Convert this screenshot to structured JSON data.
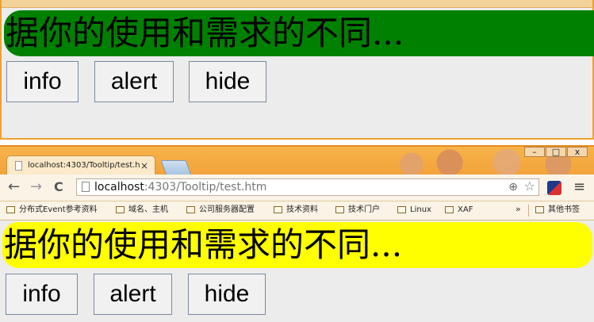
{
  "window_top": {
    "banner_text": "据你的使用和需求的不同...",
    "banner_color": "#008000",
    "buttons": {
      "info": "info",
      "alert": "alert",
      "hide": "hide"
    }
  },
  "window_bottom": {
    "tab": {
      "title": "localhost:4303/Tooltip/test.h",
      "close": "×"
    },
    "window_controls": {
      "minimize": "–",
      "maximize": "□",
      "close": "x"
    },
    "nav": {
      "back": "←",
      "forward": "→",
      "reload": "C"
    },
    "address": {
      "host": "localhost",
      "path": ":4303/Tooltip/test.htm"
    },
    "bookmarks": [
      "分布式Event参考资料",
      "域名、主机",
      "公司服务器配置",
      "技术资料",
      "技术门户",
      "Linux",
      "XAF"
    ],
    "bookmarks_more": "»",
    "other_bookmarks": "其他书签",
    "banner_text": "据你的使用和需求的不同...",
    "banner_color": "#ffff00",
    "buttons": {
      "info": "info",
      "alert": "alert",
      "hide": "hide"
    }
  }
}
